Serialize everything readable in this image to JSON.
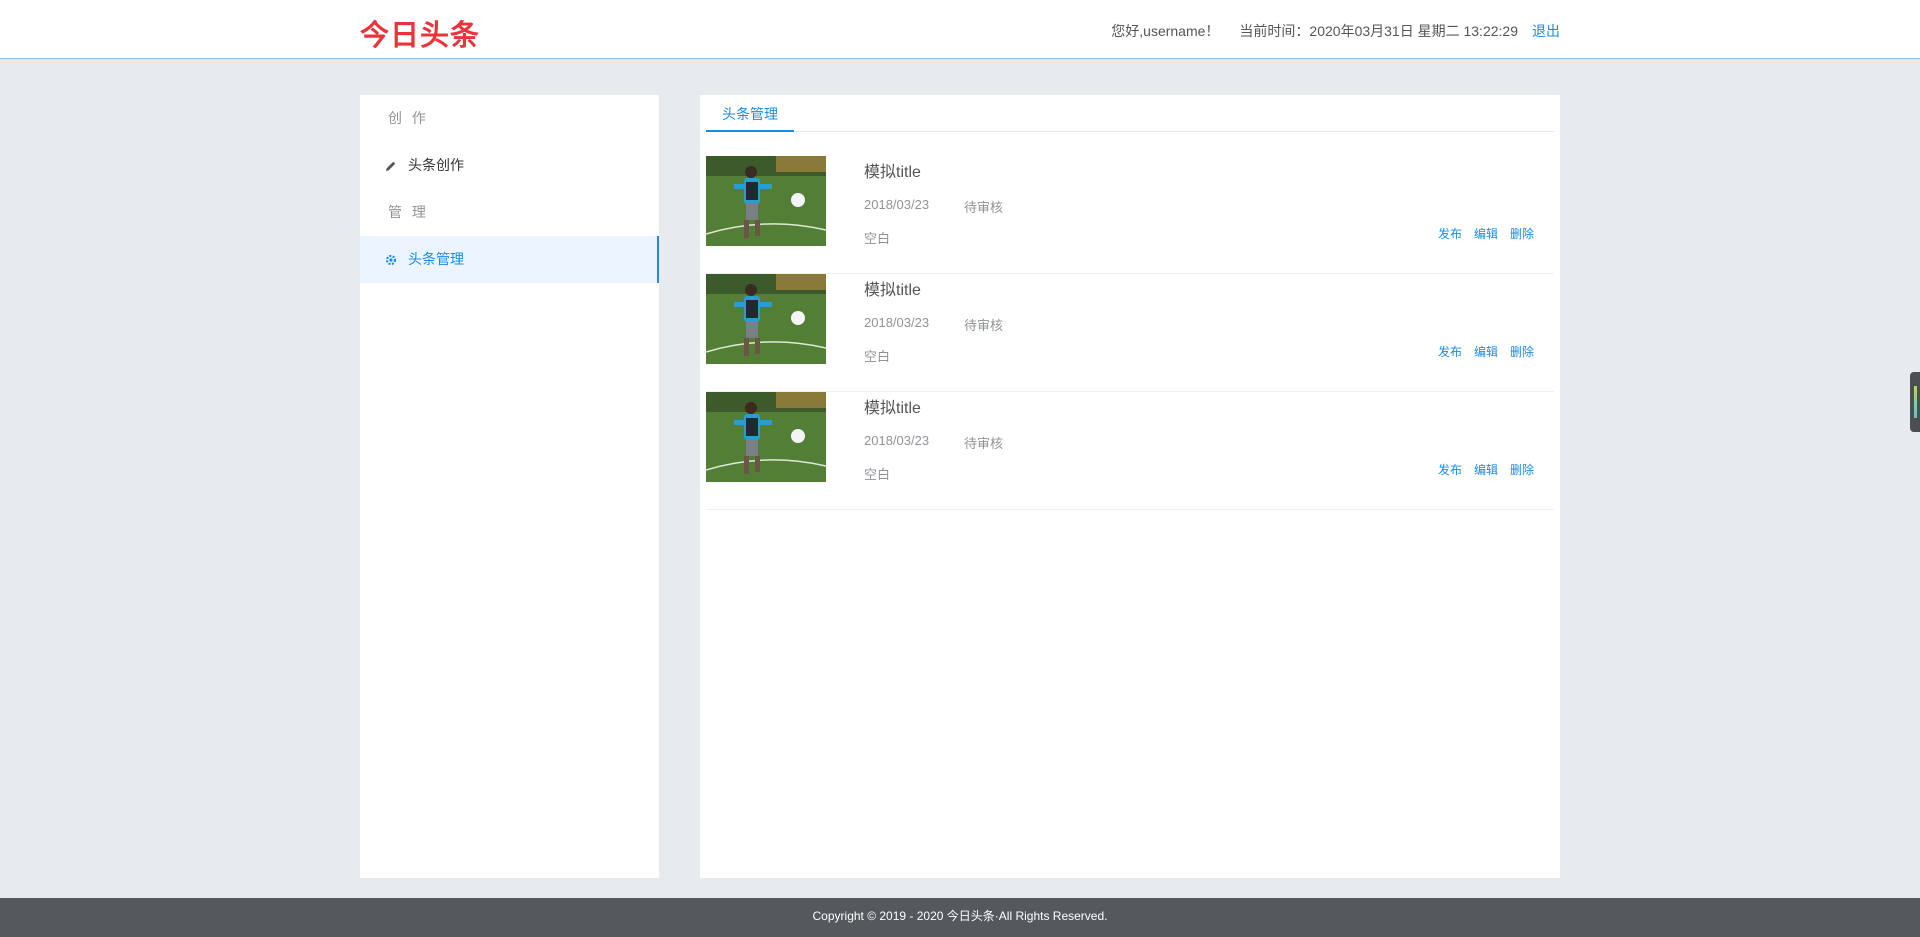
{
  "header": {
    "logo": "今日头条",
    "greeting": "您好,username！",
    "time_label": "当前时间：",
    "time_value": "2020年03月31日 星期二 13:22:29",
    "logout": "退出"
  },
  "sidebar": {
    "groups": [
      {
        "label": "创 作",
        "items": [
          {
            "label": "头条创作",
            "icon": "pencil-icon",
            "active": false
          }
        ]
      },
      {
        "label": "管 理",
        "items": [
          {
            "label": "头条管理",
            "icon": "gear-icon",
            "active": true
          }
        ]
      }
    ]
  },
  "main": {
    "tab": "头条管理",
    "articles": [
      {
        "title": "模拟title",
        "date": "2018/03/23",
        "status": "待审核",
        "summary": "空白",
        "thumbnail": "soccer-player-image"
      },
      {
        "title": "模拟title",
        "date": "2018/03/23",
        "status": "待审核",
        "summary": "空白",
        "thumbnail": "soccer-player-image"
      },
      {
        "title": "模拟title",
        "date": "2018/03/23",
        "status": "待审核",
        "summary": "空白",
        "thumbnail": "soccer-player-image"
      }
    ],
    "actions": {
      "publish": "发布",
      "edit": "编辑",
      "delete": "删除"
    }
  },
  "footer": {
    "copyright": "Copyright © 2019 - 2020 今日头条·All Rights Reserved."
  },
  "colors": {
    "brand": "#e8343a",
    "accent": "#1a8be6",
    "footer_bg": "#55595d",
    "page_bg": "#e8ebee"
  }
}
